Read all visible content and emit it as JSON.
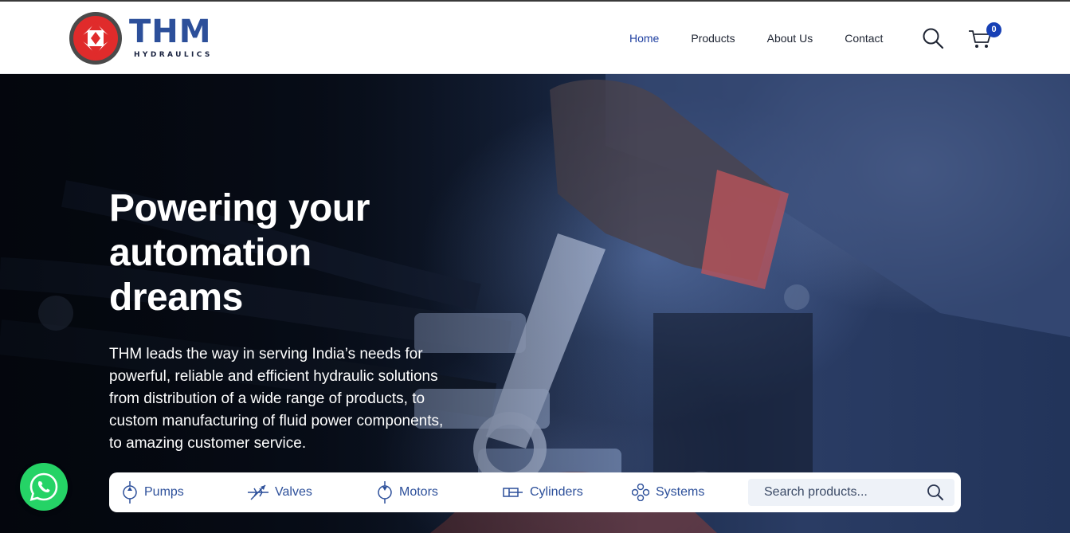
{
  "brand": {
    "name": "THM",
    "tagline": "HYDRAULICS",
    "colors": {
      "primary": "#2c4f9a",
      "logo_red": "#e02b2b",
      "badge": "#1740b5"
    }
  },
  "nav": {
    "items": [
      {
        "label": "Home",
        "active": true
      },
      {
        "label": "Products",
        "active": false
      },
      {
        "label": "About Us",
        "active": false
      },
      {
        "label": "Contact",
        "active": false
      }
    ],
    "search_icon": "search-icon",
    "cart_icon": "cart-icon",
    "cart_count": "0"
  },
  "hero": {
    "title_lines": [
      "Powering your",
      "automation",
      "dreams"
    ],
    "description": "THM leads the way in serving India’s needs for powerful, reliable and efficient hydraulic solutions from distribution of a wide range of products, to custom manufacturing of fluid power components, to amazing customer service."
  },
  "categories": [
    {
      "label": "Pumps",
      "icon": "pump-icon"
    },
    {
      "label": "Valves",
      "icon": "valve-icon"
    },
    {
      "label": "Motors",
      "icon": "motor-icon"
    },
    {
      "label": "Cylinders",
      "icon": "cylinder-icon"
    },
    {
      "label": "Systems",
      "icon": "systems-icon"
    }
  ],
  "product_search": {
    "placeholder": "Search products..."
  },
  "floating": {
    "whatsapp_icon": "whatsapp-icon",
    "whatsapp_color": "#25d366"
  }
}
